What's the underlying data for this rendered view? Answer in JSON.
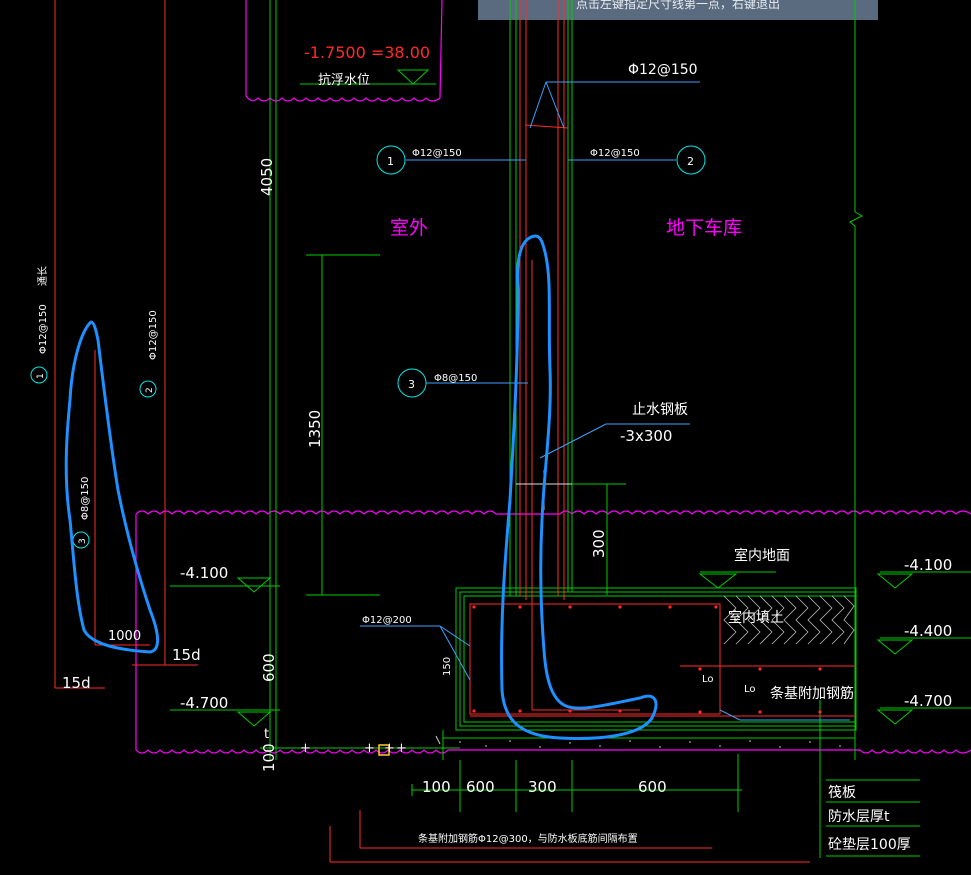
{
  "status_tip": "点击左键指定尺寸线第一点，右键退出",
  "colors": {
    "background": "#000000",
    "green": "#00cc00",
    "red": "#ff2a2a",
    "magenta": "#ff00ff",
    "cyan": "#00e5e5",
    "white": "#ffffff",
    "yellow": "#ffff66",
    "blue_markup": "#1e90ff",
    "tip_bar": "#5a6b80"
  },
  "water_level": {
    "value": "-1.7500 =38.00",
    "label": "抗浮水位"
  },
  "rooms": {
    "outside": "室外",
    "garage": "地下车库"
  },
  "rebar": {
    "r1_main": "Φ12@150",
    "r1_callout": "Φ12@150",
    "r2_callout": "Φ12@150",
    "r3_callout": "Φ8@150",
    "slab_bar": "Φ12@200",
    "detail_r1": "Φ12@150",
    "detail_r1_note": "通长",
    "detail_r2": "Φ12@150",
    "detail_r3": "Φ8@150"
  },
  "markers": {
    "m1": "1",
    "m2": "2",
    "m3": "3"
  },
  "waterstop": {
    "title": "止水钢板",
    "size": "-3x300"
  },
  "floor_label": "室内地面",
  "fill_label": "室内填土",
  "strip_rebar": "条基附加钢筋",
  "lo_labels": [
    "Lo",
    "Lo"
  ],
  "dims_vertical": [
    "4050",
    "1350",
    "600",
    "100",
    "300",
    "150"
  ],
  "dims_small": [
    "t"
  ],
  "dims_bottom": [
    "100",
    "600",
    "300",
    "600"
  ],
  "left_dims": [
    "1000",
    "15d",
    "15d"
  ],
  "elevations": [
    "-4.100",
    "-4.700",
    "-4.100",
    "-4.400",
    "-4.700"
  ],
  "layers": [
    "筏板",
    "防水层厚t",
    "砼垫层100厚"
  ],
  "bottom_note": "条基附加钢筋Φ12@300，与防水板底筋间隔布置",
  "cursor_marks": [
    "+",
    "+",
    "+",
    "+"
  ]
}
